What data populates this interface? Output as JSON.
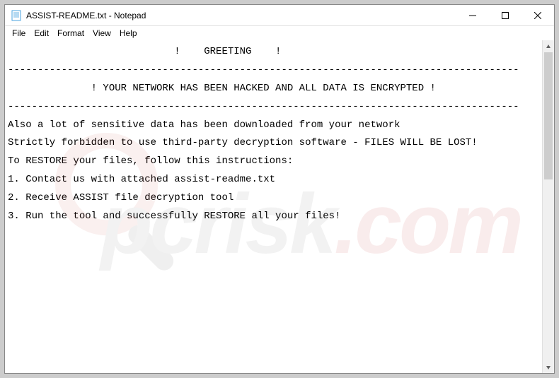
{
  "window": {
    "title": "ASSIST-README.txt - Notepad"
  },
  "menu": {
    "file": "File",
    "edit": "Edit",
    "format": "Format",
    "view": "View",
    "help": "Help"
  },
  "text": {
    "line1": "                            !    GREETING    !",
    "sep1": "--------------------------------------------------------------------------------------",
    "line2": "              ! YOUR NETWORK HAS BEEN HACKED AND ALL DATA IS ENCRYPTED !",
    "sep2": "--------------------------------------------------------------------------------------",
    "blank": "",
    "line3": "Also a lot of sensitive data has been downloaded from your network",
    "line4": "Strictly forbidden to use third-party decryption software - FILES WILL BE LOST!",
    "line5": "To RESTORE your files, follow this instructions:",
    "line6": "1. Contact us with attached assist-readme.txt",
    "line7": "2. Receive ASSIST file decryption tool",
    "line8": "3. Run the tool and successfully RESTORE all your files!"
  },
  "watermark": {
    "text_a": "pcrisk",
    "text_b": ".com"
  }
}
